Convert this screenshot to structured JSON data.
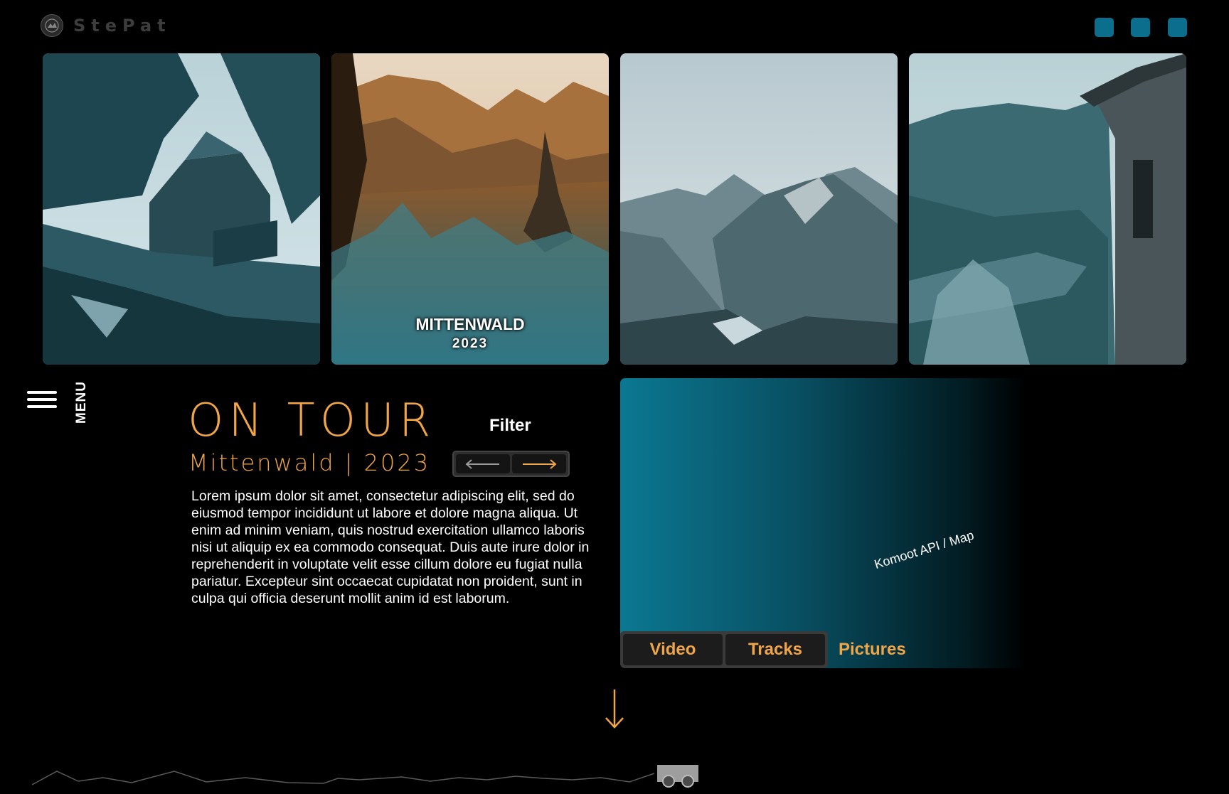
{
  "header": {
    "logo_text": "StePat",
    "social_icons": [
      "social-icon-1",
      "social-icon-2",
      "social-icon-3"
    ],
    "accent_color": "#0a6e8c"
  },
  "gallery": {
    "photos": [
      {
        "name": "mountain-hut-photo",
        "tint": "teal"
      },
      {
        "name": "mittenwald-photo",
        "tint": "sepia-teal",
        "title": "MITTENWALD",
        "year": "2023"
      },
      {
        "name": "alpine-valley-photo",
        "tint": "slate"
      },
      {
        "name": "castle-river-photo",
        "tint": "teal"
      }
    ]
  },
  "menu": {
    "label": "MENU"
  },
  "tour": {
    "title": "ON TOUR",
    "subtitle": "Mittenwald | 2023",
    "filter_label": "Filter",
    "body": "Lorem ipsum dolor sit amet, consectetur adipiscing elit, sed do eiusmod tempor incididunt ut labore et dolore magna aliqua. Ut enim ad minim veniam, quis nostrud exercitation ullamco laboris nisi ut aliquip ex ea commodo consequat. Duis aute irure dolor in reprehenderit in voluptate velit esse cillum dolore eu fugiat nulla pariatur. Excepteur sint occaecat cupidatat non proident, sunt in culpa qui officia deserunt mollit anim id est laborum."
  },
  "map": {
    "label": "Komoot API / Map",
    "tabs": [
      "Video",
      "Tracks",
      "Pictures"
    ]
  },
  "colors": {
    "accent_orange": "#f0a547",
    "map_teal": "#0b7892"
  }
}
